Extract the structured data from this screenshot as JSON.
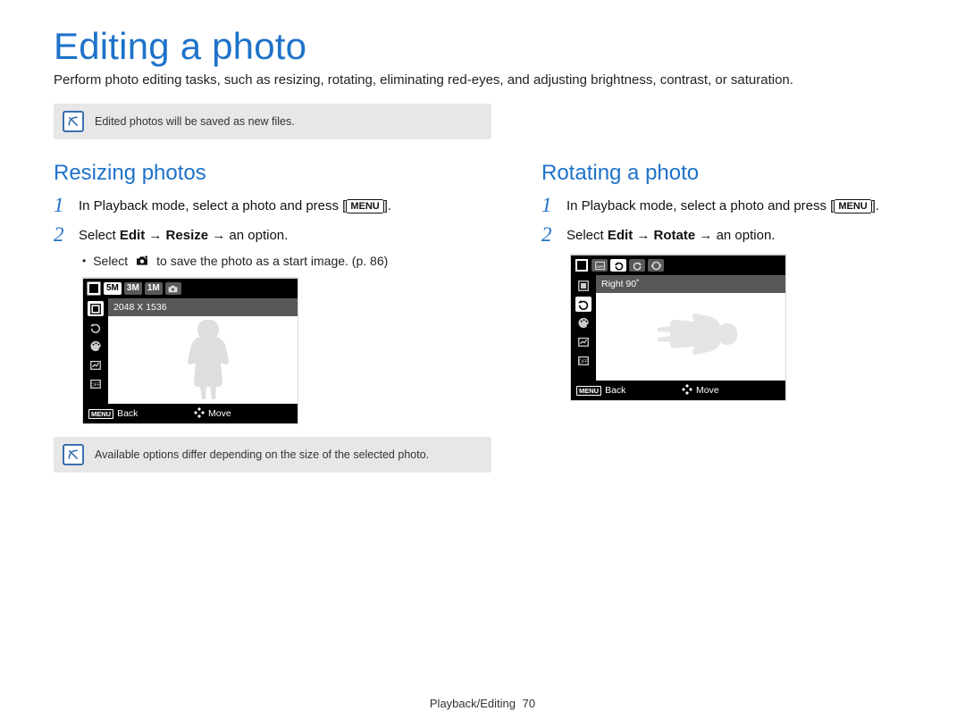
{
  "page": {
    "title": "Editing a photo",
    "intro": "Perform photo editing tasks, such as resizing, rotating, eliminating red-eyes, and adjusting brightness, contrast, or saturation.",
    "footer_section": "Playback/Editing",
    "footer_page": "70"
  },
  "notes": {
    "top": "Edited photos will be saved as new files.",
    "bottom": "Available options differ depending on the size of the selected photo."
  },
  "menu_label": "MENU",
  "left": {
    "heading": "Resizing photos",
    "step1_pre": "In Playback mode, select a photo and press [",
    "step1_post": "].",
    "step2_pre": "Select ",
    "step2_b1": "Edit",
    "step2_arrow": " → ",
    "step2_b2": "Resize",
    "step2_post": " → an option.",
    "sub_pre": "Select ",
    "sub_post": " to save the photo as a start image. (p. 86)",
    "screen": {
      "chips": [
        "5M",
        "3M",
        "1M"
      ],
      "label": "2048 X 1536",
      "back": "Back",
      "move": "Move"
    }
  },
  "right": {
    "heading": "Rotating a photo",
    "step1_pre": "In Playback mode, select a photo and press [",
    "step1_post": "].",
    "step2_pre": "Select ",
    "step2_b1": "Edit",
    "step2_arrow": " → ",
    "step2_b2": "Rotate",
    "step2_post": " → an option.",
    "screen": {
      "label": "Right 90˚",
      "back": "Back",
      "move": "Move"
    }
  },
  "step_numbers": {
    "one": "1",
    "two": "2"
  }
}
